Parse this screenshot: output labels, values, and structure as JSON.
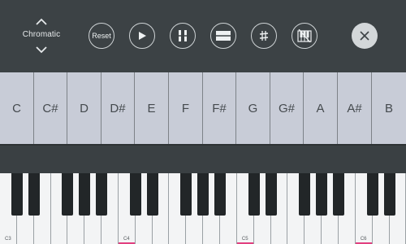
{
  "toolbar": {
    "scale_label": "Chromatic",
    "reset_label": "Reset",
    "icons": {
      "scale_up": "chevron-up-icon",
      "scale_down": "chevron-down-icon",
      "play": "play-icon",
      "pause": "pause-icon",
      "fullsize": "fullsize-icon",
      "sharp": "sharp-icon",
      "keys": "piano-keys-icon",
      "close": "close-icon"
    }
  },
  "notes": [
    "C",
    "C#",
    "D",
    "D#",
    "E",
    "F",
    "F#",
    "G",
    "G#",
    "A",
    "A#",
    "B"
  ],
  "piano": {
    "octave_labels": [
      "C3",
      "C4",
      "C5",
      "C6"
    ],
    "marker_color": "#e24080"
  },
  "colors": {
    "toolbar_bg": "#3c4245",
    "note_bg": "#c8ccd7",
    "note_text": "#454a4e",
    "marker": "#e24080"
  }
}
